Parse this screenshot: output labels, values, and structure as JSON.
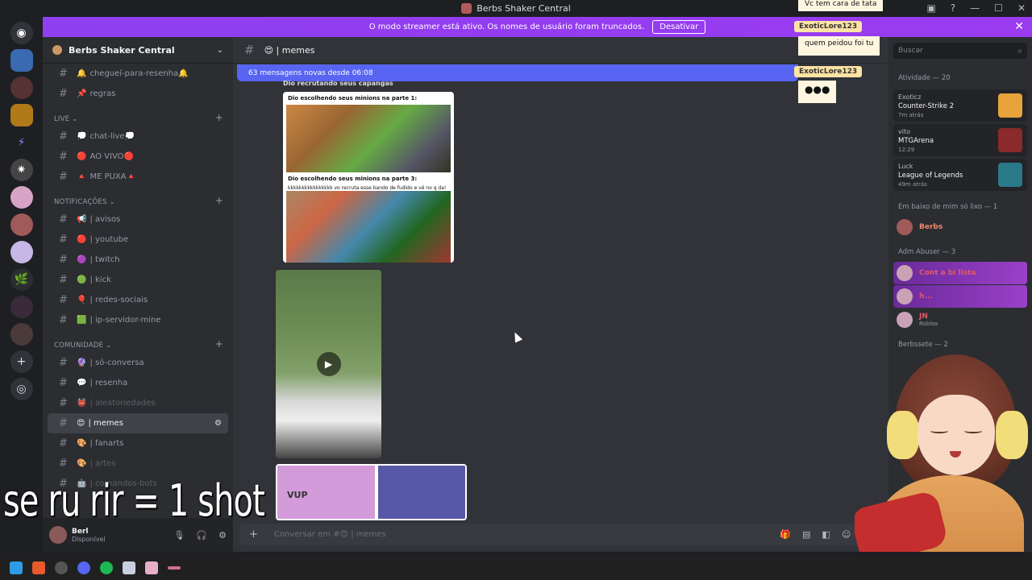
{
  "window": {
    "title": "Berbs Shaker Central"
  },
  "streamer": {
    "message": "O modo streamer está ativo. Os nomes de usuário foram truncados.",
    "button": "Desativar"
  },
  "guild": {
    "name": "Berbs Shaker Central"
  },
  "channels": {
    "top": [
      {
        "emoji": "🔔",
        "name": "chegueí-para-resenha🔔"
      },
      {
        "emoji": "📌",
        "name": "regras"
      }
    ],
    "cat_live": "Live",
    "live": [
      {
        "emoji": "💭",
        "name": "chat-live💭"
      },
      {
        "emoji": "🔴",
        "name": "AO VIVO🔴"
      },
      {
        "emoji": "🔺",
        "name": "ME PUXA🔺"
      }
    ],
    "cat_notif": "NOTIFICAÇÕES",
    "notif": [
      {
        "emoji": "📢",
        "name": "| avisos"
      },
      {
        "emoji": "🔴",
        "name": "| youtube"
      },
      {
        "emoji": "🟣",
        "name": "| twitch"
      },
      {
        "emoji": "🟢",
        "name": "| kick"
      },
      {
        "emoji": "🎈",
        "name": "| redes-sociais"
      },
      {
        "emoji": "🟩",
        "name": "| ip-servidor-mine"
      }
    ],
    "cat_comm": "COMUNIDADE",
    "comm": [
      {
        "emoji": "🔮",
        "name": "| só-conversa"
      },
      {
        "emoji": "💬",
        "name": "| resenha"
      },
      {
        "emoji": "👹",
        "name": "| aleatoriedades"
      },
      {
        "emoji": "😍",
        "name": "| memes"
      },
      {
        "emoji": "🎨",
        "name": "| fanarts"
      },
      {
        "emoji": "🎨",
        "name": "| artes"
      },
      {
        "emoji": "🤖",
        "name": "| comandos-bots"
      }
    ]
  },
  "user": {
    "name": "Berl",
    "status": "Disponível"
  },
  "header": {
    "channel": "😍 | memes"
  },
  "new_messages": "63 mensagens novas desde 06:08",
  "memes": {
    "caption": "Dio recrutando seus capangas",
    "top_text": "Dio escolhendo seus minions na parte 1:",
    "bottom_text": "Dio escolhendo seus minions na parte 3:",
    "bottom_quote": "kkkkkkkkkkkkkkkk vo recruta esse bando de fudido e vê no q da!",
    "comic_text": "VUP"
  },
  "composer": {
    "placeholder": "Conversar em #😍 | memes"
  },
  "right": {
    "search_placeholder": "Buscar",
    "activity_title": "Atividade — 20",
    "activities": [
      {
        "user": "Exoticz",
        "game": "Counter-Strike 2",
        "time": "7m atrás",
        "color": "#e8a33a"
      },
      {
        "user": "vito",
        "game": "MTGArena",
        "time": "12:29",
        "color": "#8a2a2a"
      },
      {
        "user": "Luck",
        "game": "League of Legends",
        "time": "49m atrás",
        "color": "#2a7a8a"
      }
    ],
    "group1": "Em baixo de mim só lixo — 1",
    "member1": "Berbs",
    "group2": "Adm Abuser — 3",
    "members2": [
      {
        "name": "Cont a bi lista",
        "sub": ""
      },
      {
        "name": "h...",
        "sub": ""
      },
      {
        "name": "JN",
        "sub": "Roblox"
      }
    ],
    "group3": "Berbssete — 2"
  },
  "overlay": {
    "top_msg": "Vc tem cara de tata",
    "name": "ExoticLore123",
    "msg1": "quem peidou foi tu",
    "msg2": "●●●"
  },
  "caption": "se ru rir = 1 shot"
}
